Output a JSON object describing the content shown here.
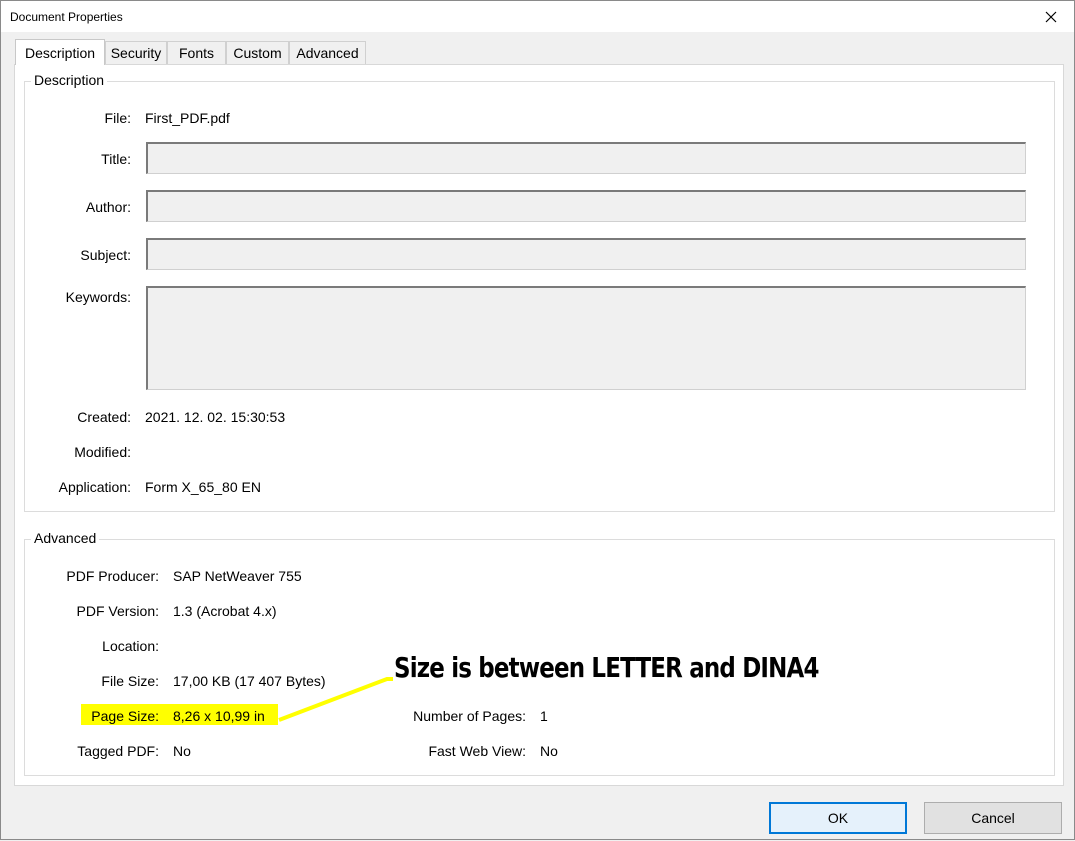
{
  "window": {
    "title": "Document Properties"
  },
  "tabs": [
    {
      "label": "Description",
      "active": true
    },
    {
      "label": "Security"
    },
    {
      "label": "Fonts"
    },
    {
      "label": "Custom"
    },
    {
      "label": "Advanced"
    }
  ],
  "description": {
    "group_label": "Description",
    "file": {
      "label": "File:",
      "value": "First_PDF.pdf"
    },
    "title": {
      "label": "Title:",
      "value": ""
    },
    "author": {
      "label": "Author:",
      "value": ""
    },
    "subject": {
      "label": "Subject:",
      "value": ""
    },
    "keywords": {
      "label": "Keywords:",
      "value": ""
    },
    "created": {
      "label": "Created:",
      "value": "2021. 12. 02. 15:30:53"
    },
    "modified": {
      "label": "Modified:",
      "value": ""
    },
    "application": {
      "label": "Application:",
      "value": "Form X_65_80 EN"
    }
  },
  "advanced": {
    "group_label": "Advanced",
    "pdf_producer": {
      "label": "PDF Producer:",
      "value": "SAP NetWeaver 755"
    },
    "pdf_version": {
      "label": "PDF Version:",
      "value": "1.3 (Acrobat 4.x)"
    },
    "location": {
      "label": "Location:",
      "value": ""
    },
    "file_size": {
      "label": "File Size:",
      "value": "17,00 KB (17 407 Bytes)"
    },
    "page_size": {
      "label": "Page Size:",
      "value": "8,26 x 10,99 in"
    },
    "tagged_pdf": {
      "label": "Tagged PDF:",
      "value": "No"
    },
    "number_of_pages": {
      "label": "Number of Pages:",
      "value": "1"
    },
    "fast_web_view": {
      "label": "Fast Web View:",
      "value": "No"
    }
  },
  "annotation": {
    "text": "Size is between LETTER and DINA4",
    "color": "#ffff00"
  },
  "buttons": {
    "ok": "OK",
    "cancel": "Cancel"
  },
  "colors": {
    "highlight": "#ffff00",
    "default_button_border": "#0078d7"
  }
}
